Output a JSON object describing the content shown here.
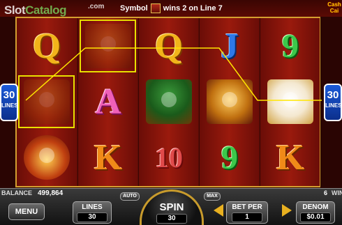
{
  "top": {
    "watermark_brand": "Slot",
    "watermark_brand2": "Catalog",
    "watermark_suffix": ".com",
    "win_message_prefix": "Symbol",
    "win_message_suffix": "wins 2 on Line 7",
    "logo_text": "Cash Cai"
  },
  "lines_badge": {
    "number": "30",
    "label": "LINES"
  },
  "bottom": {
    "balance_label": "BALANCE",
    "balance_value": "499,864",
    "win_count": "6",
    "win_label": "WIN",
    "menu_label": "MENU",
    "lines_label": "LINES",
    "lines_value": "30",
    "auto_label": "AUTO",
    "max_label": "MAX",
    "spin_label": "SPIN",
    "spin_value": "30",
    "bet_per_label": "BET PER",
    "bet_per_value": "1",
    "denom_label": "DENOM",
    "denom_value": "$0.01"
  },
  "colors": {
    "gold": "#d4a030",
    "highlight": "#e8e000",
    "badge_blue": "#1b5ad8"
  },
  "reels": [
    {
      "symbols": [
        {
          "text": "Q",
          "kind": "q"
        },
        {
          "text": "",
          "kind": "tiger-pic",
          "dim": true,
          "highlighted": true
        },
        {
          "text": "",
          "kind": "bag-pic"
        }
      ]
    },
    {
      "symbols": [
        {
          "text": "",
          "kind": "tiger-pic",
          "dim": true,
          "highlighted": true
        },
        {
          "text": "A",
          "kind": "a"
        },
        {
          "text": "K",
          "kind": "k"
        }
      ]
    },
    {
      "symbols": [
        {
          "text": "Q",
          "kind": "q"
        },
        {
          "text": "",
          "kind": "tree-pic"
        },
        {
          "text": "10",
          "kind": "ten"
        }
      ]
    },
    {
      "symbols": [
        {
          "text": "J",
          "kind": "j"
        },
        {
          "text": "",
          "kind": "dragon-pic"
        },
        {
          "text": "9",
          "kind": "nine"
        }
      ]
    },
    {
      "symbols": [
        {
          "text": "9",
          "kind": "nine"
        },
        {
          "text": "",
          "kind": "cat-pic"
        },
        {
          "text": "K",
          "kind": "k"
        }
      ]
    }
  ]
}
